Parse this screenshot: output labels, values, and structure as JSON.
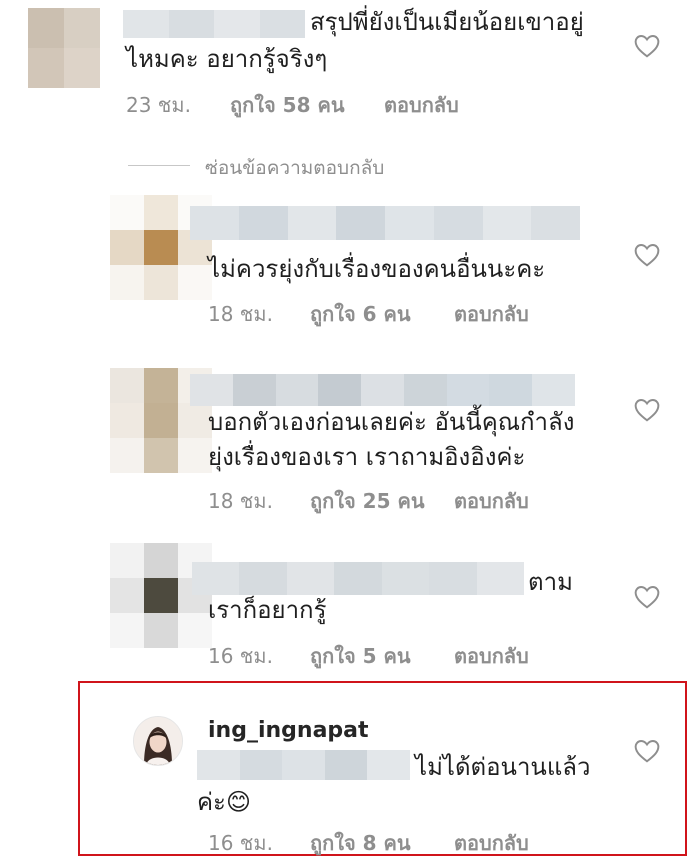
{
  "comments": [
    {
      "text_lines": [
        "สรุปพี่ยังเป็นเมียน้อยเขาอยู่",
        "ไหมคะ อยากรู้จริงๆ"
      ],
      "time": "23 ชม.",
      "likes": "ถูกใจ 58 คน",
      "reply": "ตอบกลับ"
    },
    {
      "text_lines": [
        "ไม่ควรยุ่งกับเรื่องของคนอื่นนะคะ"
      ],
      "time": "18 ชม.",
      "likes": "ถูกใจ 6 คน",
      "reply": "ตอบกลับ"
    },
    {
      "text_lines": [
        "บอกตัวเองก่อนเลยค่ะ อันนี้คุณกำลัง",
        "ยุ่งเรื่องของเรา เราถามอิงอิงค่ะ"
      ],
      "time": "18 ชม.",
      "likes": "ถูกใจ 25 คน",
      "reply": "ตอบกลับ"
    },
    {
      "text_lines": [
        "ตาม",
        "เราก็อยากรู้"
      ],
      "time": "16 ชม.",
      "likes": "ถูกใจ 5 คน",
      "reply": "ตอบกลับ"
    },
    {
      "username": "ing_ingnapat",
      "text_lines": [
        "ไม่ได้ต่อนานแล้ว",
        "ค่ะ😊"
      ],
      "time": "16 ชม.",
      "likes": "ถูกใจ 8 คน",
      "reply": "ตอบกลับ"
    }
  ],
  "hide_replies_label": "ซ่อนข้อความตอบกลับ",
  "colors": {
    "highlight_border": "#d0141b",
    "meta_text": "#8e8e8e"
  },
  "icons": {
    "like": "heart-outline-icon"
  }
}
